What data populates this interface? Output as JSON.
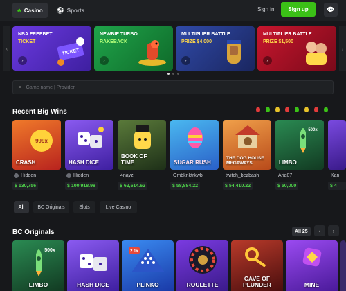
{
  "topbar": {
    "tabs": [
      {
        "label": "Casino",
        "icon": "club-icon",
        "active": true
      },
      {
        "label": "Sports",
        "icon": "ball-icon",
        "active": false
      }
    ],
    "signin_label": "Sign in",
    "signup_label": "Sign up",
    "accent": "#3bc117"
  },
  "banners": [
    {
      "title": "NBA FREEBET",
      "subtitle": "TICKET",
      "subtitle_color": "#ffd84a",
      "bg": "#5a2fc8",
      "art_label": "TICKET"
    },
    {
      "title": "NEWBIE TURBO",
      "subtitle": "RAKEBACK",
      "subtitle_color": "#b4ff7a",
      "bg": "#1f9a3a",
      "art_label": ""
    },
    {
      "title": "MULTIPLIER BATTLE",
      "subtitle": "PRIZE $4,000",
      "subtitle_color": "#ffd84a",
      "bg": "#2c3c8e",
      "art_label": ""
    },
    {
      "title": "MULTIPLIER BATTLE",
      "subtitle": "PRIZE $1,500",
      "subtitle_color": "#ffd84a",
      "bg": "#b3132b",
      "art_label": ""
    }
  ],
  "search": {
    "placeholder": "Game name | Provider"
  },
  "recent_wins": {
    "title": "Recent Big Wins",
    "items": [
      {
        "game": "CRASH",
        "badge": "999x",
        "user": "Hidden",
        "amount": "$ 130,756",
        "bg": "#e0482c"
      },
      {
        "game": "HASH DICE",
        "badge": "",
        "user": "Hidden",
        "amount": "$ 100,918.98",
        "bg": "#6b3cd6"
      },
      {
        "game": "BOOK OF TIME",
        "badge": "",
        "user": "4nayz",
        "amount": "$ 62,614.62",
        "bg": "#3c5a2a"
      },
      {
        "game": "SUGAR RUSH",
        "badge": "",
        "user": "Ombknktrkwb",
        "amount": "$ 58,884.22",
        "bg": "#2c8fd6"
      },
      {
        "game": "THE DOG HOUSE MEGAWAYS",
        "badge": "",
        "user": "twitch_bezbash",
        "amount": "$ 54,410.22",
        "bg": "#d96b1e"
      },
      {
        "game": "LIMBO",
        "badge": "500x",
        "user": "Aria07",
        "amount": "$ 50,000",
        "bg": "#1f6a42"
      },
      {
        "game": "",
        "badge": "",
        "user": "Kan",
        "amount": "$ 4",
        "bg": "#5a2fa8"
      }
    ]
  },
  "filters": [
    {
      "label": "All",
      "active": true
    },
    {
      "label": "BC Originals",
      "active": false
    },
    {
      "label": "Slots",
      "active": false
    },
    {
      "label": "Live Casino",
      "active": false
    }
  ],
  "originals": {
    "title": "BC Originals",
    "all_label": "All 25",
    "items": [
      {
        "game": "LIMBO",
        "badge": "500x",
        "bg": "#1f6a42"
      },
      {
        "game": "HASH DICE",
        "badge": "",
        "bg": "#6b3cd6"
      },
      {
        "game": "PLINKO",
        "badge": "2.1x",
        "bg": "#2a5fd6"
      },
      {
        "game": "ROULETTE",
        "badge": "",
        "bg": "#6b2cc4"
      },
      {
        "game": "CAVE OF PLUNDER",
        "badge": "",
        "bg": "#8a2424"
      },
      {
        "game": "MINE",
        "badge": "",
        "bg": "#7a2fc8"
      }
    ]
  }
}
